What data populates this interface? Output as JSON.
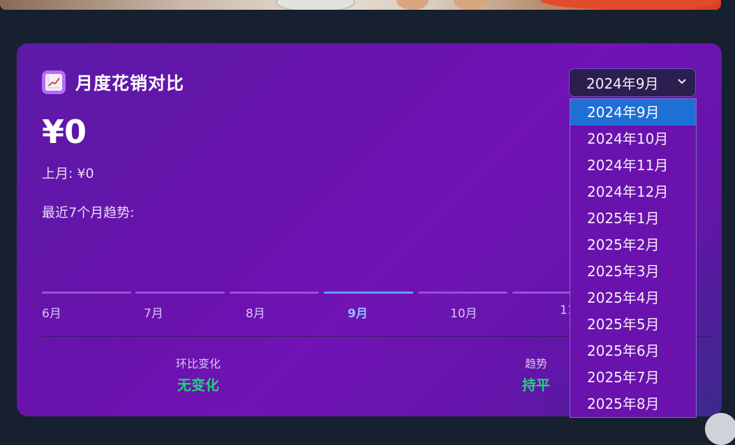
{
  "header": {
    "title": "月度花销对比",
    "icon": "chart-increasing-icon",
    "amount": "¥0",
    "last_month": "上月: ¥0",
    "trend_label": "最近7个月趋势:"
  },
  "trend": {
    "months": [
      {
        "label": "6月",
        "active": false
      },
      {
        "label": "7月",
        "active": false
      },
      {
        "label": "8月",
        "active": false
      },
      {
        "label": "9月",
        "active": true
      },
      {
        "label": "10月",
        "active": false
      },
      {
        "label": "11",
        "active": false
      }
    ]
  },
  "stats": {
    "change_label": "环比变化",
    "change_value": "无变化",
    "trend_label": "趋势",
    "trend_value": "持平"
  },
  "month_select": {
    "value": "2024年9月",
    "options": [
      "2024年9月",
      "2024年10月",
      "2024年11月",
      "2024年12月",
      "2025年1月",
      "2025年2月",
      "2025年3月",
      "2025年4月",
      "2025年5月",
      "2025年6月",
      "2025年7月",
      "2025年8月"
    ],
    "highlighted": "2024年9月"
  },
  "colors": {
    "page_bg": "#16202f",
    "card_purple": "#6a12ad",
    "positive_green": "#22d07a",
    "active_blue": "#5aa2ff",
    "option_highlight": "#1e6fd6"
  }
}
